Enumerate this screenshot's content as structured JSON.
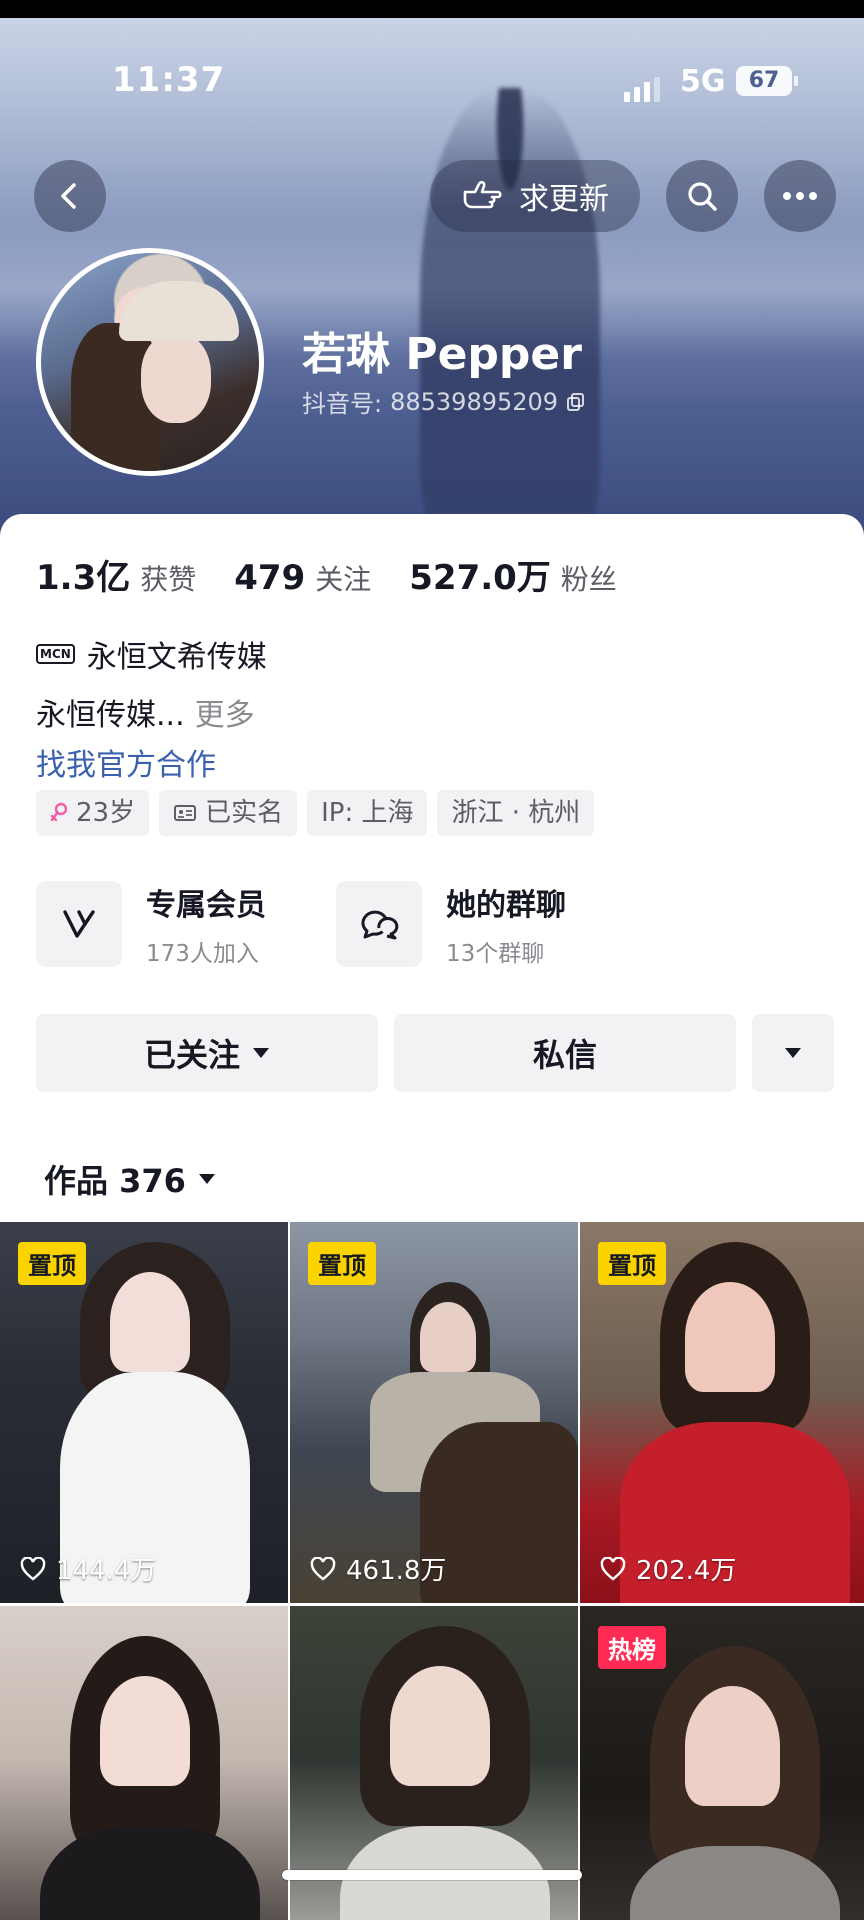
{
  "status_bar": {
    "time": "11:37",
    "network": "5G",
    "battery": "67"
  },
  "header": {
    "request_update_label": "求更新"
  },
  "profile": {
    "name": "若琳 Pepper",
    "douyin_id_label": "抖音号:",
    "douyin_id": "88539895209"
  },
  "stats": [
    {
      "value": "1.3亿",
      "label": "获赞"
    },
    {
      "value": "479",
      "label": "关注"
    },
    {
      "value": "527.0万",
      "label": "粉丝"
    }
  ],
  "mcn": {
    "badge": "MCN",
    "name": "永恒文希传媒"
  },
  "bio": {
    "text": "永恒传媒...",
    "more": "更多"
  },
  "cooperation_link": "找我官方合作",
  "tags": [
    {
      "text": "23岁",
      "icon": "female-icon"
    },
    {
      "text": "已实名",
      "icon": "id-card-icon"
    },
    {
      "text": "IP: 上海"
    },
    {
      "text": "浙江 · 杭州"
    }
  ],
  "features": [
    {
      "title": "专属会员",
      "subtitle": "173人加入",
      "icon": "vip-icon"
    },
    {
      "title": "她的群聊",
      "subtitle": "13个群聊",
      "icon": "group-chat-icon"
    }
  ],
  "actions": {
    "follow": "已关注",
    "message": "私信"
  },
  "works_tab": {
    "label": "作品 376"
  },
  "videos": [
    {
      "badge": "置顶",
      "badge_type": "pin",
      "likes": "144.4万"
    },
    {
      "badge": "置顶",
      "badge_type": "pin",
      "likes": "461.8万"
    },
    {
      "badge": "置顶",
      "badge_type": "pin",
      "likes": "202.4万"
    },
    {
      "badge": "",
      "badge_type": "none",
      "likes": ""
    },
    {
      "badge": "",
      "badge_type": "none",
      "likes": ""
    },
    {
      "badge": "热榜",
      "badge_type": "hot",
      "likes": ""
    }
  ],
  "colors": {
    "accent_link": "#3b62ad",
    "pin_badge": "#fbd400",
    "hot_badge": "#fe2c55",
    "header_dark": "#3a4a7c"
  }
}
